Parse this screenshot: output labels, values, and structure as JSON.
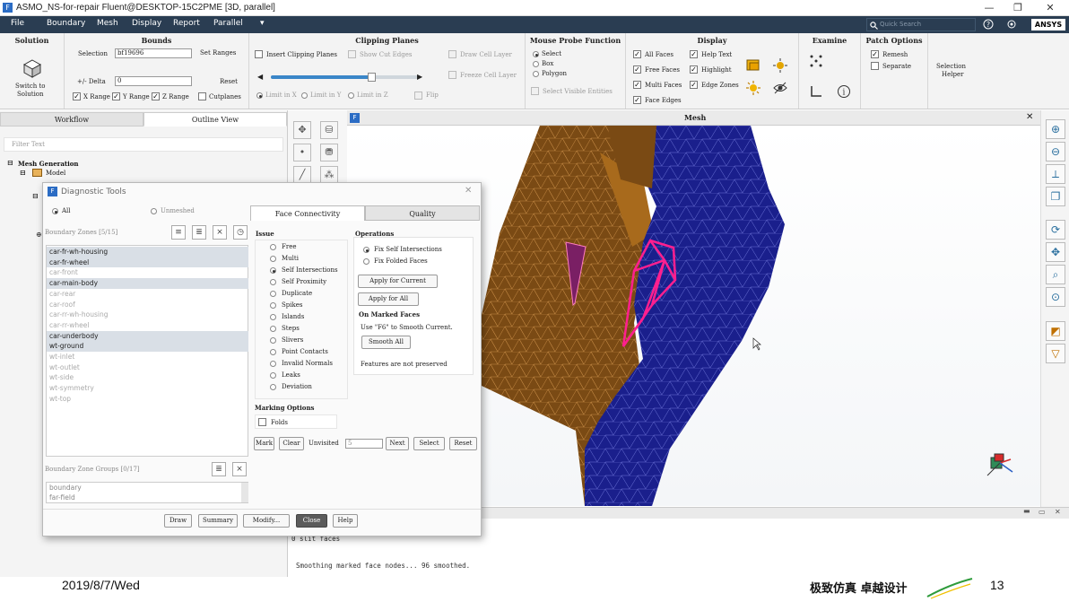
{
  "window": {
    "title": "ASMO_NS-for-repair Fluent@DESKTOP-15C2PME  [3D, parallel]",
    "logo_text": "F",
    "minimize": "—",
    "restore": "❐",
    "close": "✕"
  },
  "menu": {
    "items": [
      "File",
      "Boundary",
      "Mesh",
      "Display",
      "Report",
      "Parallel"
    ],
    "dropdown_icon": "▾",
    "search_placeholder": "Quick Search",
    "brand": "ANSYS"
  },
  "ribbon": {
    "solution": {
      "title": "Solution",
      "switch_label_1": "Switch to",
      "switch_label_2": "Solution"
    },
    "bounds": {
      "title": "Bounds",
      "selection_label": "Selection",
      "selection_value": "bf19696",
      "set_ranges": "Set Ranges",
      "delta_label": "+/- Delta",
      "delta_value": "0",
      "reset": "Reset",
      "x_range": "X Range",
      "y_range": "Y Range",
      "z_range": "Z Range",
      "cutplanes": "Cutplanes"
    },
    "clipping": {
      "title": "Clipping Planes",
      "insert": "Insert Clipping Planes",
      "show_cut_edges": "Show Cut Edges",
      "draw_cell_layer": "Draw Cell Layer",
      "freeze_cell_layer": "Freeze Cell Layer",
      "limit_x": "Limit in X",
      "limit_y": "Limit in Y",
      "limit_z": "Limit in Z",
      "flip": "Flip",
      "slider_position": 0.68
    },
    "probe": {
      "title": "Mouse Probe Function",
      "select": "Select",
      "box": "Box",
      "polygon": "Polygon",
      "select_visible": "Select Visible Entities"
    },
    "display": {
      "title": "Display",
      "all_faces": "All Faces",
      "free_faces": "Free Faces",
      "multi_faces": "Multi Faces",
      "face_edges": "Face Edges",
      "help_text": "Help Text",
      "highlight": "Highlight",
      "edge_zones": "Edge Zones"
    },
    "examine": {
      "title": "Examine"
    },
    "patch": {
      "title": "Patch Options",
      "remesh": "Remesh",
      "separate": "Separate"
    },
    "selection_helper_1": "Selection",
    "selection_helper_2": "Helper"
  },
  "left_panel": {
    "tabs": [
      "Workflow",
      "Outline View"
    ],
    "filter_placeholder": "Filter Text",
    "tree_root": "Mesh Generation",
    "tree_model": "Model"
  },
  "graphics": {
    "title": "Mesh",
    "close": "✕"
  },
  "dialog": {
    "title": "Diagnostic Tools",
    "close": "✕",
    "all": "All",
    "unmeshed": "Unmeshed",
    "boundary_zones_label": "Boundary Zones [5/15]",
    "zones": [
      {
        "name": "car-fr-wh-housing",
        "selected": true
      },
      {
        "name": "car-fr-wheel",
        "selected": true
      },
      {
        "name": "car-front",
        "selected": false
      },
      {
        "name": "car-main-body",
        "selected": true
      },
      {
        "name": "car-rear",
        "selected": false
      },
      {
        "name": "car-roof",
        "selected": false
      },
      {
        "name": "car-rr-wh-housing",
        "selected": false
      },
      {
        "name": "car-rr-wheel",
        "selected": false
      },
      {
        "name": "car-underbody",
        "selected": true
      },
      {
        "name": "wt-ground",
        "selected": true
      },
      {
        "name": "wt-inlet",
        "selected": false
      },
      {
        "name": "wt-outlet",
        "selected": false
      },
      {
        "name": "wt-side",
        "selected": false
      },
      {
        "name": "wt-symmetry",
        "selected": false
      },
      {
        "name": "wt-top",
        "selected": false
      }
    ],
    "groups_label": "Boundary Zone Groups [0/17]",
    "groups": [
      "boundary",
      "far-field"
    ],
    "tabs": [
      "Face Connectivity",
      "Quality"
    ],
    "issue_title": "Issue",
    "issues": [
      "Free",
      "Multi",
      "Self Intersections",
      "Self Proximity",
      "Duplicate",
      "Spikes",
      "Islands",
      "Steps",
      "Slivers",
      "Point Contacts",
      "Invalid Normals",
      "Leaks",
      "Deviation"
    ],
    "selected_issue": "Self Intersections",
    "operations_title": "Operations",
    "op_fix_self": "Fix Self Intersections",
    "op_fix_folded": "Fix Folded Faces",
    "apply_current": "Apply for Current",
    "apply_all": "Apply for All",
    "on_marked": "On Marked Faces",
    "f6_hint": "Use \"F6\" to Smooth Current.",
    "smooth_all": "Smooth All",
    "features_note": "Features are not preserved",
    "marking_options": "Marking Options",
    "folds": "Folds",
    "mark": "Mark",
    "clear": "Clear",
    "unvisited": "Unvisited",
    "unvisited_value": "5",
    "next": "Next",
    "select": "Select",
    "reset": "Reset",
    "draw": "Draw",
    "summary": "Summary",
    "modify": "Modify...",
    "close_btn": "Close",
    "help": "Help"
  },
  "console": {
    "lines": [
      "0 slit faces",
      "",
      "Smoothing marked face nodes... 96 smoothed."
    ]
  },
  "footer": {
    "date": "2019/8/7/Wed",
    "slogan": "极致仿真 卓越设计",
    "page": "13"
  },
  "colors": {
    "menubar": "#2a3d52",
    "brown_mesh": "#7a4a14",
    "blue_mesh": "#1a1f8c",
    "highlight": "#ff1f8f"
  }
}
